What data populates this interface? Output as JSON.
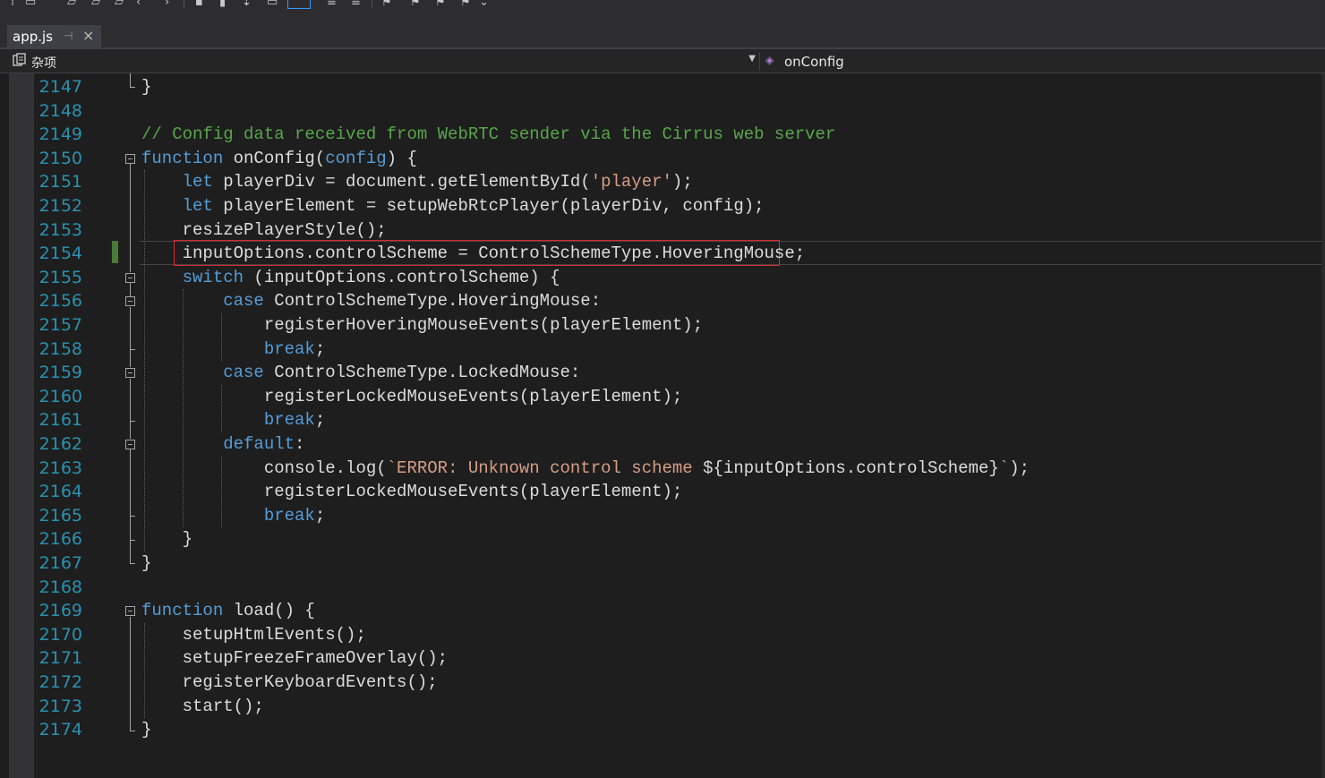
{
  "colors": {
    "background": "#1e1e1e",
    "line_number": "#2b91af",
    "keyword": "#569cd6",
    "comment": "#57a64a",
    "string": "#d69d85",
    "text": "#dcdcdc",
    "highlight_box": "#e0282c"
  },
  "tab": {
    "title": "app.js",
    "pin_icon": "pin-icon",
    "close_icon": "close-icon"
  },
  "navbar": {
    "project": "杂项",
    "member": "onConfig"
  },
  "lines": [
    {
      "num": "2147",
      "segments": [
        {
          "t": "}",
          "c": "tx"
        }
      ]
    },
    {
      "num": "2148",
      "segments": []
    },
    {
      "num": "2149",
      "segments": [
        {
          "t": "// Config data received from WebRTC sender via the Cirrus web server",
          "c": "cm"
        }
      ]
    },
    {
      "num": "2150",
      "segments": [
        {
          "t": "function",
          "c": "kw"
        },
        {
          "t": " onConfig(",
          "c": "tx"
        },
        {
          "t": "config",
          "c": "kw"
        },
        {
          "t": ") {",
          "c": "tx"
        }
      ]
    },
    {
      "num": "2151",
      "segments": [
        {
          "t": "    ",
          "c": "tx"
        },
        {
          "t": "let",
          "c": "kw"
        },
        {
          "t": " playerDiv = document.getElementById(",
          "c": "tx"
        },
        {
          "t": "'player'",
          "c": "st"
        },
        {
          "t": ");",
          "c": "tx"
        }
      ]
    },
    {
      "num": "2152",
      "segments": [
        {
          "t": "    ",
          "c": "tx"
        },
        {
          "t": "let",
          "c": "kw"
        },
        {
          "t": " playerElement = setupWebRtcPlayer(playerDiv, config);",
          "c": "tx"
        }
      ]
    },
    {
      "num": "2153",
      "segments": [
        {
          "t": "    resizePlayerStyle();",
          "c": "tx"
        }
      ]
    },
    {
      "num": "2154",
      "segments": [
        {
          "t": "    inputOptions.controlScheme = ControlSchemeType.HoveringMouse;",
          "c": "tx"
        }
      ]
    },
    {
      "num": "2155",
      "segments": [
        {
          "t": "    ",
          "c": "tx"
        },
        {
          "t": "switch",
          "c": "kw"
        },
        {
          "t": " (inputOptions.controlScheme) {",
          "c": "tx"
        }
      ]
    },
    {
      "num": "2156",
      "segments": [
        {
          "t": "        ",
          "c": "tx"
        },
        {
          "t": "case",
          "c": "kw"
        },
        {
          "t": " ControlSchemeType.HoveringMouse:",
          "c": "tx"
        }
      ]
    },
    {
      "num": "2157",
      "segments": [
        {
          "t": "            registerHoveringMouseEvents(playerElement);",
          "c": "tx"
        }
      ]
    },
    {
      "num": "2158",
      "segments": [
        {
          "t": "            ",
          "c": "tx"
        },
        {
          "t": "break",
          "c": "kw"
        },
        {
          "t": ";",
          "c": "tx"
        }
      ]
    },
    {
      "num": "2159",
      "segments": [
        {
          "t": "        ",
          "c": "tx"
        },
        {
          "t": "case",
          "c": "kw"
        },
        {
          "t": " ControlSchemeType.LockedMouse:",
          "c": "tx"
        }
      ]
    },
    {
      "num": "2160",
      "segments": [
        {
          "t": "            registerLockedMouseEvents(playerElement);",
          "c": "tx"
        }
      ]
    },
    {
      "num": "2161",
      "segments": [
        {
          "t": "            ",
          "c": "tx"
        },
        {
          "t": "break",
          "c": "kw"
        },
        {
          "t": ";",
          "c": "tx"
        }
      ]
    },
    {
      "num": "2162",
      "segments": [
        {
          "t": "        ",
          "c": "tx"
        },
        {
          "t": "default",
          "c": "kw"
        },
        {
          "t": ":",
          "c": "tx"
        }
      ]
    },
    {
      "num": "2163",
      "segments": [
        {
          "t": "            console.log(",
          "c": "tx"
        },
        {
          "t": "`ERROR: Unknown control scheme ",
          "c": "st"
        },
        {
          "t": "${inputOptions.controlScheme}",
          "c": "tx"
        },
        {
          "t": "`",
          "c": "st"
        },
        {
          "t": ");",
          "c": "tx"
        }
      ]
    },
    {
      "num": "2164",
      "segments": [
        {
          "t": "            registerLockedMouseEvents(playerElement);",
          "c": "tx"
        }
      ]
    },
    {
      "num": "2165",
      "segments": [
        {
          "t": "            ",
          "c": "tx"
        },
        {
          "t": "break",
          "c": "kw"
        },
        {
          "t": ";",
          "c": "tx"
        }
      ]
    },
    {
      "num": "2166",
      "segments": [
        {
          "t": "    }",
          "c": "tx"
        }
      ]
    },
    {
      "num": "2167",
      "segments": [
        {
          "t": "}",
          "c": "tx"
        }
      ]
    },
    {
      "num": "2168",
      "segments": []
    },
    {
      "num": "2169",
      "segments": [
        {
          "t": "function",
          "c": "kw"
        },
        {
          "t": " load() {",
          "c": "tx"
        }
      ]
    },
    {
      "num": "2170",
      "segments": [
        {
          "t": "    setupHtmlEvents();",
          "c": "tx"
        }
      ]
    },
    {
      "num": "2171",
      "segments": [
        {
          "t": "    setupFreezeFrameOverlay();",
          "c": "tx"
        }
      ]
    },
    {
      "num": "2172",
      "segments": [
        {
          "t": "    registerKeyboardEvents();",
          "c": "tx"
        }
      ]
    },
    {
      "num": "2173",
      "segments": [
        {
          "t": "    start();",
          "c": "tx"
        }
      ]
    },
    {
      "num": "2174",
      "segments": [
        {
          "t": "}",
          "c": "tx"
        }
      ]
    }
  ]
}
